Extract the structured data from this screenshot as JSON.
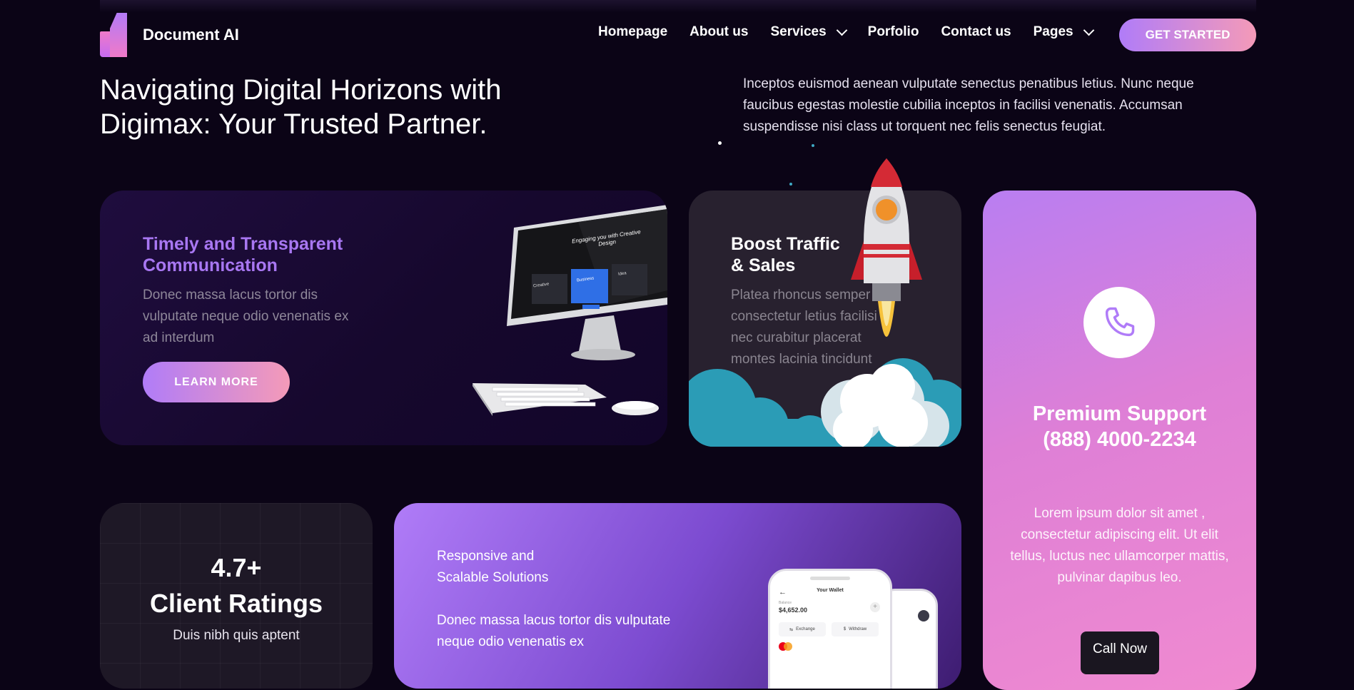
{
  "header": {
    "brand": "Document AI",
    "nav": [
      {
        "label": "Homepage"
      },
      {
        "label": "About us"
      },
      {
        "label": "Services"
      },
      {
        "label": "Porfolio"
      },
      {
        "label": "Contact us"
      },
      {
        "label": "Pages"
      }
    ],
    "cta_label": "GET STARTED"
  },
  "hero": {
    "title_line1": "Navigating Digital Horizons with",
    "title_line2": "Digimax: Your Trusted Partner.",
    "description": "Inceptos euismod aenean vulputate senectus penatibus letius. Nunc neque faucibus egestas molestie cubilia inceptos in facilisi venenatis. Accumsan suspendisse nisi class ut torquent nec felis senectus feugiat."
  },
  "card_communication": {
    "title_line1": "Timely and Transparent",
    "title_line2": "Communication",
    "text": "Donec massa lacus tortor dis vulputate neque odio venenatis ex ad interdum",
    "button": "LEARN MORE",
    "screen_heading": "Engaging you with Creative Design",
    "screen_tiles": [
      "Creative",
      "Business",
      "Idea"
    ]
  },
  "card_traffic": {
    "title_line1": "Boost Traffic",
    "title_line2": "& Sales",
    "text": "Platea rhoncus semper consectetur letius facilisi nec curabitur placerat montes lacinia tincidunt"
  },
  "card_support": {
    "title_line1": "Premium Support",
    "title_line2": "(888) 4000-2234",
    "text": "Lorem ipsum dolor sit amet , consectetur adipiscing elit. Ut elit tellus, luctus nec ullamcorper mattis, pulvinar dapibus leo.",
    "button": "Call Now"
  },
  "card_ratings": {
    "number": "4.7+",
    "title": "Client Ratings",
    "text": "Duis nibh quis aptent"
  },
  "card_responsive": {
    "title_line1": "Responsive and",
    "title_line2": "Scalable Solutions",
    "text": "Donec massa lacus tortor dis vulputate neque odio venenatis ex",
    "wallet_title": "Your Wallet",
    "wallet_balance_label": "Balance",
    "wallet_balance": "$4,652.00",
    "wallet_actions": [
      "Exchange",
      "Withdraw"
    ]
  },
  "colors": {
    "background": "#0b0416",
    "accent_purple": "#b07cf8",
    "accent_pink": "#f49ab8",
    "title_purple": "#a877f2"
  }
}
